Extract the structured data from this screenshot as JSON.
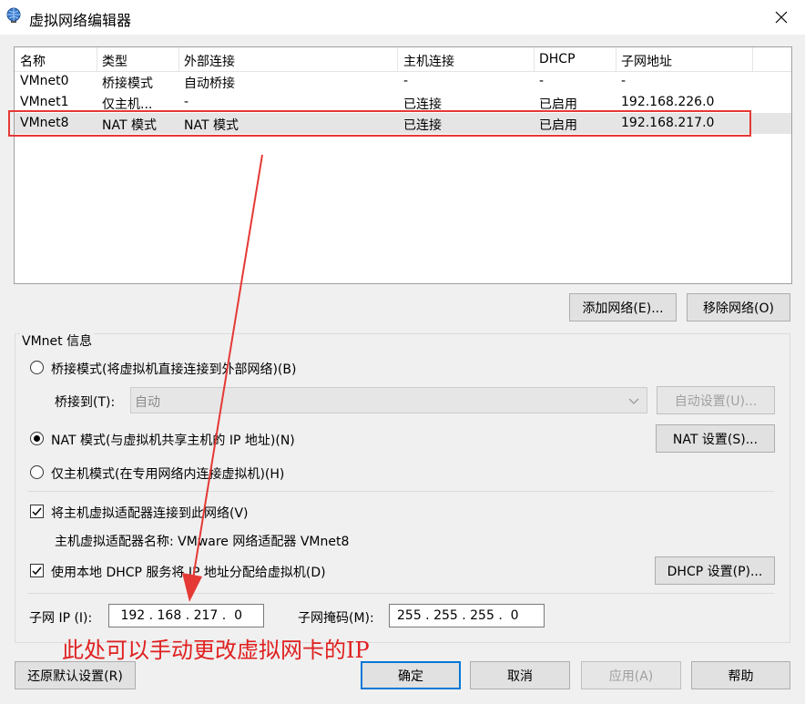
{
  "window": {
    "title": "虚拟网络编辑器"
  },
  "table": {
    "columns": [
      "名称",
      "类型",
      "外部连接",
      "主机连接",
      "DHCP",
      "子网地址"
    ],
    "rows": [
      [
        "VMnet0",
        "桥接模式",
        "自动桥接",
        "-",
        "-",
        "-"
      ],
      [
        "VMnet1",
        "仅主机...",
        "-",
        "已连接",
        "已启用",
        "192.168.226.0"
      ],
      [
        "VMnet8",
        "NAT 模式",
        "NAT 模式",
        "已连接",
        "已启用",
        "192.168.217.0"
      ]
    ],
    "selected_row": 2
  },
  "buttons": {
    "add_network": "添加网络(E)...",
    "remove_network": "移除网络(O)",
    "auto_settings": "自动设置(U)...",
    "nat_settings": "NAT 设置(S)...",
    "dhcp_settings": "DHCP 设置(P)...",
    "restore_defaults": "还原默认设置(R)",
    "ok": "确定",
    "cancel": "取消",
    "apply": "应用(A)",
    "help": "帮助"
  },
  "vmnet_info": {
    "group_label": "VMnet 信息",
    "bridged_label": "桥接模式(将虚拟机直接连接到外部网络)(B)",
    "bridged_to_label": "桥接到(T):",
    "bridged_to_value": "自动",
    "nat_label": "NAT 模式(与虚拟机共享主机的 IP 地址)(N)",
    "hostonly_label": "仅主机模式(在专用网络内连接虚拟机)(H)",
    "selected_mode": "nat",
    "connect_adapter_label": "将主机虚拟适配器连接到此网络(V)",
    "connect_adapter_checked": true,
    "adapter_name_label": "主机虚拟适配器名称: VMware 网络适配器 VMnet8",
    "use_dhcp_label": "使用本地 DHCP 服务将 IP 地址分配给虚拟机(D)",
    "use_dhcp_checked": true,
    "subnet_ip_label": "子网 IP (I):",
    "subnet_ip": " 192 . 168 . 217 .  0",
    "subnet_mask_label": "子网掩码(M):",
    "subnet_mask": "255 . 255 . 255 .  0"
  },
  "annotation": {
    "text": "此处可以手动更改虚拟网卡的IP",
    "color": "#e02020"
  },
  "colors": {
    "highlight_box": "#e53935",
    "default_button_border": "#0078d7"
  }
}
